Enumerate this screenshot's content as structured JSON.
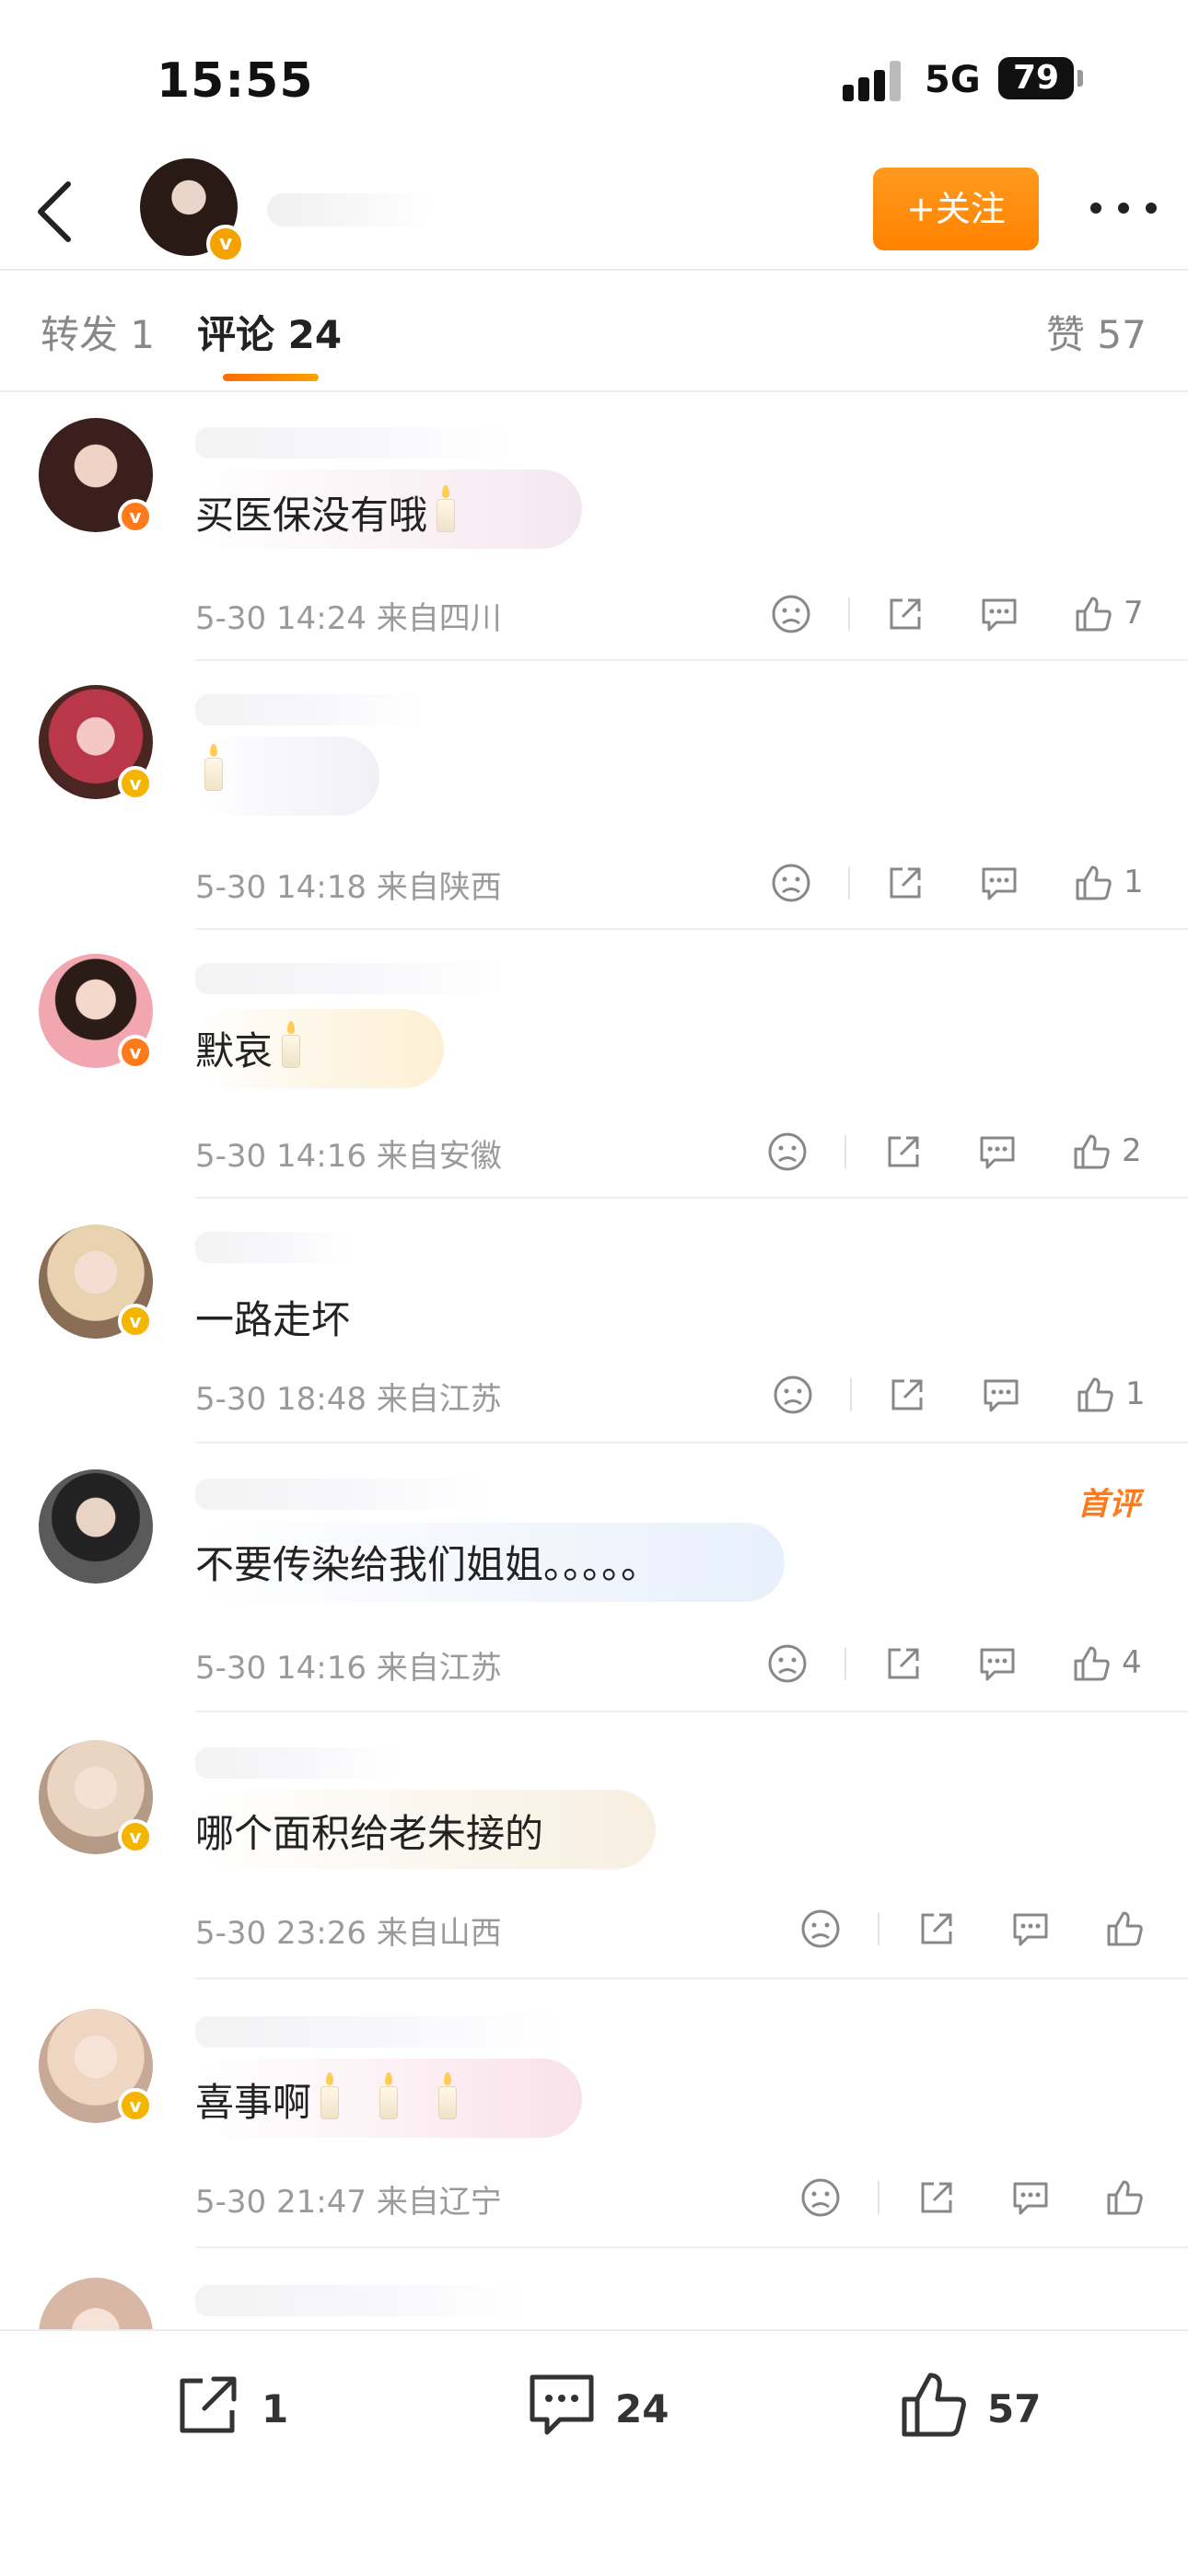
{
  "status_bar": {
    "time": "15:55",
    "network": "5G",
    "battery": "79"
  },
  "header": {
    "follow_label": "+关注"
  },
  "tabs": [
    {
      "label": "转发 1"
    },
    {
      "label": "评论 24"
    },
    {
      "label": "赞 57"
    }
  ],
  "comments": [
    {
      "text": "买医保没有哦",
      "candles": 1,
      "time": "5-30 14:24",
      "location": "来自四川",
      "likes": "7",
      "first_comment": ""
    },
    {
      "text": "",
      "candles": 1,
      "time": "5-30 14:18",
      "location": "来自陕西",
      "likes": "1",
      "first_comment": ""
    },
    {
      "text": "默哀",
      "candles": 1,
      "time": "5-30 14:16",
      "location": "来自安徽",
      "likes": "2",
      "first_comment": ""
    },
    {
      "text": "一路走坏",
      "candles": 0,
      "time": "5-30 18:48",
      "location": "来自江苏",
      "likes": "1",
      "first_comment": ""
    },
    {
      "text": "不要传染给我们姐姐。。。。。",
      "candles": 0,
      "time": "5-30 14:16",
      "location": "来自江苏",
      "likes": "4",
      "first_comment": "首评"
    },
    {
      "text": "哪个面积给老朱接的",
      "candles": 0,
      "time": "5-30 23:26",
      "location": "来自山西",
      "likes": "",
      "first_comment": ""
    },
    {
      "text": "喜事啊",
      "candles": 3,
      "time": "5-30 21:47",
      "location": "来自辽宁",
      "likes": "",
      "first_comment": ""
    }
  ],
  "bottom_bar": {
    "repost_count": "1",
    "comment_count": "24",
    "like_count": "57"
  },
  "icons": {
    "back": "chevron-left-icon",
    "more": "more-dots-icon",
    "dislike": "frown-face-icon",
    "share": "share-icon",
    "reply": "comment-bubble-icon",
    "like": "thumbs-up-icon"
  },
  "colors": {
    "accent": "#ff8200",
    "tab_underline": "#ff6b00",
    "first_comment_tag": "#ff7a1a"
  }
}
